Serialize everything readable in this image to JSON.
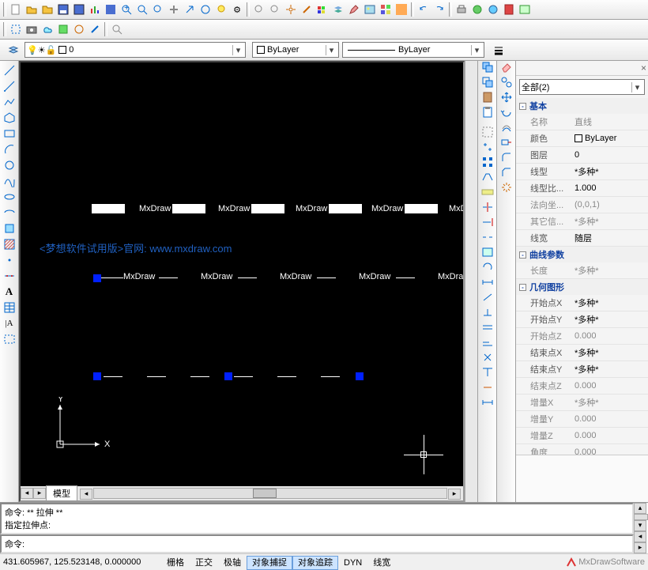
{
  "layer": {
    "current": "0",
    "color_label": "ByLayer",
    "linetype_label": "ByLayer"
  },
  "canvas": {
    "watermark_text": "MxDraw",
    "trial_text": "<梦想软件试用版>官网: www.mxdraw.com",
    "ucs_x": "X",
    "ucs_y": "Y",
    "tab_model": "模型"
  },
  "properties": {
    "selector": "全部(2)",
    "groups": [
      {
        "title": "基本",
        "rows": [
          {
            "name": "名称",
            "value": "直线",
            "dis": true
          },
          {
            "name": "颜色",
            "value": "ByLayer",
            "swatch": true
          },
          {
            "name": "图层",
            "value": "0"
          },
          {
            "name": "线型",
            "value": "*多种*"
          },
          {
            "name": "线型比...",
            "value": "1.000"
          },
          {
            "name": "法向坐...",
            "value": "(0,0,1)",
            "dis": true
          },
          {
            "name": "其它信...",
            "value": "*多种*",
            "dis": true
          },
          {
            "name": "线宽",
            "value": "随层"
          }
        ]
      },
      {
        "title": "曲线参数",
        "rows": [
          {
            "name": "长度",
            "value": "*多种*",
            "dis": true
          }
        ]
      },
      {
        "title": "几何图形",
        "rows": [
          {
            "name": "开始点X",
            "value": "*多种*"
          },
          {
            "name": "开始点Y",
            "value": "*多种*"
          },
          {
            "name": "开始点Z",
            "value": "0.000",
            "dis": true
          },
          {
            "name": "结束点X",
            "value": "*多种*"
          },
          {
            "name": "结束点Y",
            "value": "*多种*"
          },
          {
            "name": "结束点Z",
            "value": "0.000",
            "dis": true
          },
          {
            "name": "增量X",
            "value": "*多种*",
            "dis": true
          },
          {
            "name": "增量Y",
            "value": "0.000",
            "dis": true
          },
          {
            "name": "增量Z",
            "value": "0.000",
            "dis": true
          },
          {
            "name": "角度",
            "value": "0.000",
            "dis": true
          }
        ]
      }
    ]
  },
  "command": {
    "hist1": "命令: ** 拉伸 **",
    "hist2": "指定拉伸点:",
    "prompt": "命令:"
  },
  "status": {
    "coords": "431.605967,  125.523148,  0.000000",
    "buttons": [
      {
        "label": "栅格",
        "on": false
      },
      {
        "label": "正交",
        "on": false
      },
      {
        "label": "极轴",
        "on": false
      },
      {
        "label": "对象捕捉",
        "on": true
      },
      {
        "label": "对象追踪",
        "on": true
      },
      {
        "label": "DYN",
        "on": false
      },
      {
        "label": "线宽",
        "on": false
      }
    ],
    "brand": "MxDrawSoftware"
  }
}
